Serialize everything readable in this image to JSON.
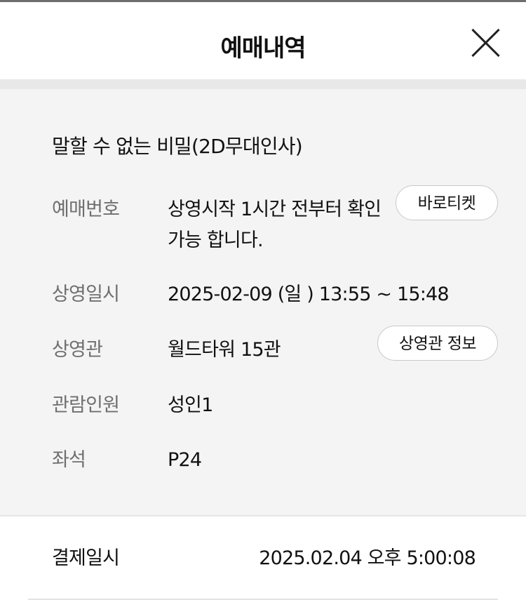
{
  "header": {
    "title": "예매내역",
    "close_icon": "close-icon"
  },
  "booking": {
    "movie_title": "말할 수 없는 비밀(2D무대인사)",
    "rows": [
      {
        "label": "예매번호",
        "value_line1": "상영시작 1시간 전부터 확인",
        "value_line2": "가능 합니다.",
        "button": "바로티켓"
      },
      {
        "label": "상영일시",
        "value": "2025-02-09 (일 ) 13:55 ~ 15:48"
      },
      {
        "label": "상영관",
        "value": "월드타워 15관",
        "button": "상영관 정보"
      },
      {
        "label": "관람인원",
        "value": "성인1"
      },
      {
        "label": "좌석",
        "value": "P24"
      }
    ]
  },
  "payment": {
    "label": "결제일시",
    "value": "2025.02.04 오후 5:00:08"
  }
}
